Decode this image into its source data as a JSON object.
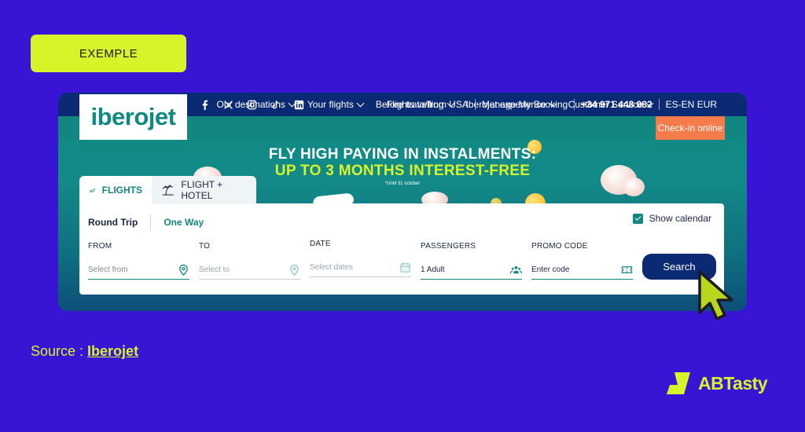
{
  "tag_label": "EXEMPLE",
  "site": {
    "logo": {
      "text_a": "ibero",
      "text_b": "jet"
    },
    "socials": [
      "facebook-icon",
      "x-icon",
      "instagram-icon",
      "tiktok-icon",
      "linkedin-icon"
    ],
    "top_links": [
      "Flights to/from USA",
      "Manage My Booking",
      "+34 971 448 082",
      "ES-EN EUR"
    ],
    "nav": [
      "Our destinations",
      "Your flights",
      "Before travelling",
      "Iberojet experience",
      "Customer Service"
    ],
    "checkin_label": "Check-in online",
    "promo": {
      "line1": "FLY HIGH PAYING IN INSTALMENTS:",
      "line2": "UP TO 3 MONTHS INTEREST-FREE",
      "note": "*Until 31 october"
    },
    "tabs": [
      {
        "label": "FLIGHTS",
        "icon": "plane-icon"
      },
      {
        "label": "FLIGHT + HOTEL",
        "icon": "palm-tree-icon"
      }
    ],
    "trip_types": {
      "round_trip": "Round Trip",
      "one_way": "One Way"
    },
    "show_calendar": {
      "label": "Show calendar",
      "checked": true
    },
    "fields": {
      "from": {
        "label": "FROM",
        "value": "Select from"
      },
      "to": {
        "label": "TO",
        "value": "Select to"
      },
      "date": {
        "label": "DATE",
        "value": "Select dates"
      },
      "passengers": {
        "label": "PASSENGERS",
        "value": "1 Adult"
      },
      "promo": {
        "label": "PROMO CODE",
        "value": "Enter code"
      }
    },
    "search_label": "Search"
  },
  "source": {
    "prefix": "Source : ",
    "link": "Iberojet"
  },
  "brand": {
    "name": "ABTasty"
  },
  "colors": {
    "page_bg": "#3A14D4",
    "accent_yellow": "#D7F32A",
    "iberojet_teal": "#12877F",
    "iberojet_navy": "#0A2A74",
    "checkin_orange": "#F47C4A"
  }
}
